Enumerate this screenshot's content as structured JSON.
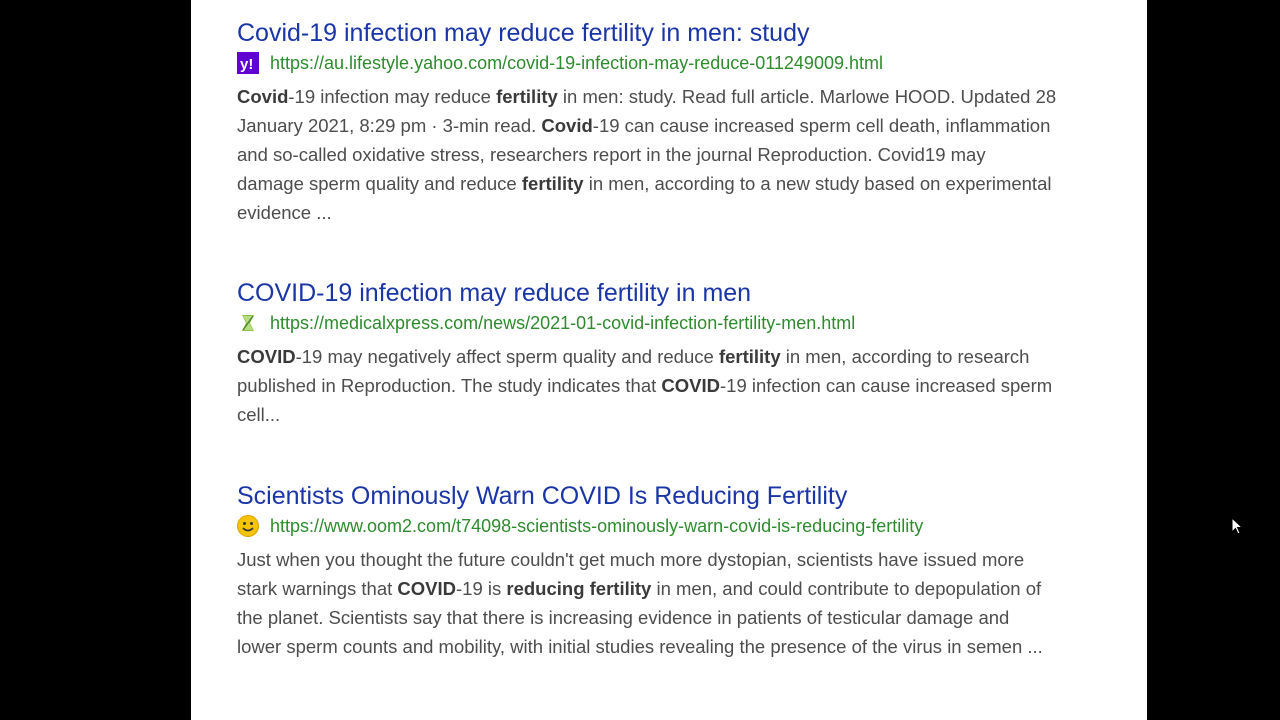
{
  "results": [
    {
      "title": "Covid-19 infection may reduce fertility in men: study",
      "url": "https://au.lifestyle.yahoo.com/covid-19-infection-may-reduce-011249009.html",
      "favicon": "yahoo-icon",
      "snippet": [
        {
          "t": "Covid",
          "b": true
        },
        {
          "t": "-19 infection may reduce ",
          "b": false
        },
        {
          "t": "fertility",
          "b": true
        },
        {
          "t": " in men: study. Read full article. Marlowe HOOD. Updated 28 January 2021, 8:29 pm · 3-min read. ",
          "b": false
        },
        {
          "t": "Covid",
          "b": true
        },
        {
          "t": "-19 can cause increased sperm cell death, inflammation and so-called oxidative stress, researchers report in the journal Reproduction. Covid19 may damage sperm quality and reduce ",
          "b": false
        },
        {
          "t": "fertility",
          "b": true
        },
        {
          "t": " in men, according to a new study based on experimental evidence ...",
          "b": false
        }
      ]
    },
    {
      "title": "COVID-19 infection may reduce fertility in men",
      "url": "https://medicalxpress.com/news/2021-01-covid-infection-fertility-men.html",
      "favicon": "medicalxpress-icon",
      "snippet": [
        {
          "t": "COVID",
          "b": true
        },
        {
          "t": "-19 may negatively affect sperm quality and reduce ",
          "b": false
        },
        {
          "t": "fertility",
          "b": true
        },
        {
          "t": " in men, according to research published in Reproduction. The study indicates that ",
          "b": false
        },
        {
          "t": "COVID",
          "b": true
        },
        {
          "t": "-19 infection can cause increased sperm cell...",
          "b": false
        }
      ]
    },
    {
      "title": "Scientists Ominously Warn COVID Is Reducing Fertility",
      "url": "https://www.oom2.com/t74098-scientists-ominously-warn-covid-is-reducing-fertility",
      "favicon": "smiley-icon",
      "snippet": [
        {
          "t": "Just when you thought the future couldn't get much more dystopian, scientists have issued more stark warnings that ",
          "b": false
        },
        {
          "t": "COVID",
          "b": true
        },
        {
          "t": "-19 is ",
          "b": false
        },
        {
          "t": "reducing fertility",
          "b": true
        },
        {
          "t": " in men, and could contribute to depopulation of the planet. Scientists say that there is increasing evidence in patients of testicular damage and lower sperm counts and mobility, with initial studies revealing the presence of the virus in semen ...",
          "b": false
        }
      ]
    }
  ],
  "colors": {
    "title": "#1a35a6",
    "url": "#2e8b2e",
    "snippet": "#4d4d4d",
    "yahoo": "#5f01d1",
    "smiley": "#f5c400"
  }
}
